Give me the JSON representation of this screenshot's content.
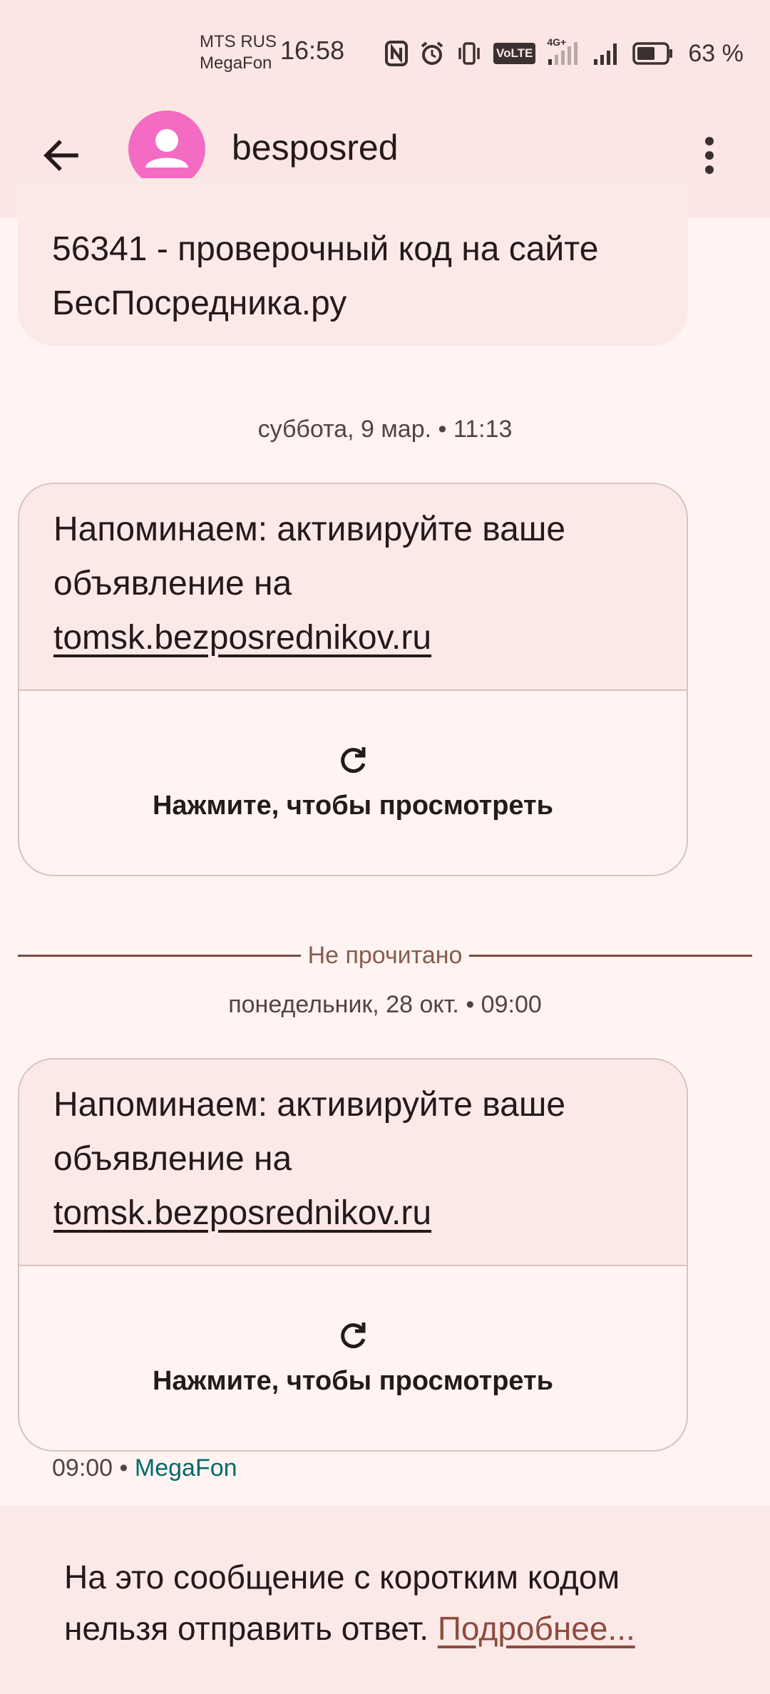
{
  "status_bar": {
    "carrier_1": "MTS RUS",
    "carrier_2": "MegaFon",
    "time": "16:58",
    "icons": [
      "nfc-icon",
      "alarm-icon",
      "vibrate-icon",
      "volte-icon",
      "signal-4g-icon",
      "signal-icon",
      "battery-icon"
    ],
    "volte_label": "VoLTE",
    "network_label": "4G+",
    "battery_percent": "63 %"
  },
  "app_bar": {
    "contact_name": "besposred",
    "avatar_color": "#f36bc2"
  },
  "messages": [
    {
      "text": "56341 - проверочный код на сайте БесПосредника.ру"
    }
  ],
  "conversation": {
    "date_1": "суббота, 9 мар. • 11:13",
    "message_2": {
      "text": "Напоминаем: активируйте ваше объявление на",
      "link": "tomsk.bezposrednikov.ru",
      "preview_label": "Нажмите, чтобы просмотреть"
    },
    "unread_label": "Не прочитано",
    "date_2": "понедельник, 28 окт. • 09:00",
    "message_3": {
      "text": "Напоминаем: активируйте ваше объявление на",
      "link": "tomsk.bezposrednikov.ru",
      "preview_label": "Нажмите, чтобы просмотреть"
    },
    "last_time": "09:00",
    "last_separator": "•",
    "last_sim": "MegaFon"
  },
  "footer": {
    "notice": "На это сообщение с коротким кодом нельзя отправить ответ.",
    "link": "Подробнее..."
  },
  "colors": {
    "background": "#fff4f2",
    "bar": "#fce6e3",
    "bubble": "#fbe9e7",
    "link_accent": "#8f4b3f",
    "sim_accent": "#006a6a"
  }
}
